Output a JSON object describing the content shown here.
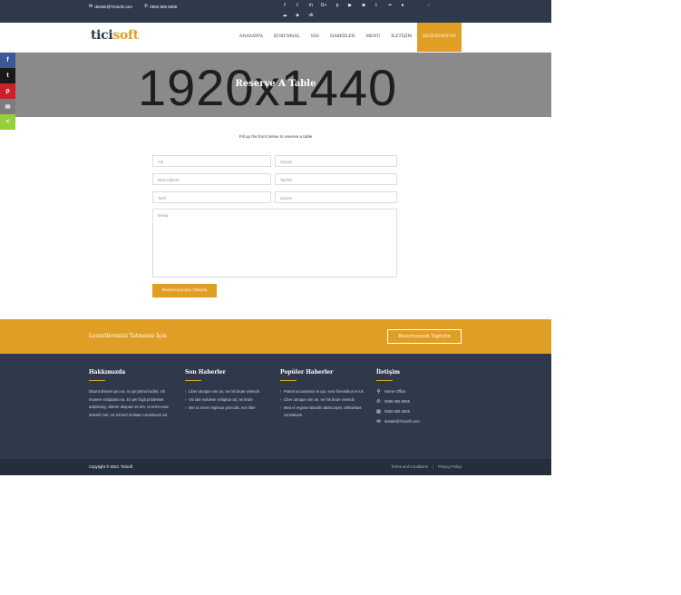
{
  "topbar": {
    "email": "destek@Ticisoft.com",
    "phone": "0555 555 5555",
    "social_icons": [
      "facebook-icon",
      "twitter-icon",
      "linkedin-icon",
      "google-plus-icon",
      "pinterest-icon",
      "youtube-icon",
      "instagram-icon",
      "tumblr-icon",
      "flickr-icon",
      "reddit-icon",
      "whatsapp-icon",
      "soundcloud-icon",
      "dropbox-icon",
      "vk-icon"
    ]
  },
  "logo": {
    "part1": "tici",
    "part2": "soft"
  },
  "nav": {
    "items": [
      "ANASAYFA",
      "KURUMSAL",
      "SSS",
      "HABERLER",
      "MENU",
      "İLETİŞİM",
      "REZERVASYON"
    ],
    "active_index": 6
  },
  "hero": {
    "placeholder": "1920x1440",
    "title": "Reserve A Table"
  },
  "share": {
    "labels": [
      "f",
      "t",
      "p",
      "✉",
      "<"
    ],
    "colors": [
      "#3b5998",
      "#1a1a1a",
      "#cb2027",
      "#7d7d7d",
      "#95d03a"
    ]
  },
  "form": {
    "intro": "Fill up the form below to reserve a table",
    "name_placeholder": "Adı",
    "surname_placeholder": "Soyadı",
    "email_placeholder": "Mail Address",
    "phone_placeholder": "Telefon",
    "date_placeholder": "Tarih",
    "time_placeholder": "Zaman",
    "message_placeholder": "Mesaj",
    "submit_label": "Rezervasyonu Onayla"
  },
  "cta": {
    "text": "Lezzetlerimizi Tatmanız İçin",
    "button_label": "Rezervasyon Yaptırın"
  },
  "footer": {
    "about": {
      "title": "Hakkımızda",
      "text": "Dicunt dissere pro ea, no pri prima facilisi. Sit munere voluptaria ea. Ex per fugit prodesset adipiscing, viderer aliquam et vim. Id enim esse deleniti mel, vix eirmod omittam constituam ad."
    },
    "news": {
      "title": "Son Haberler",
      "items": [
        "Liber utroque vim an, ne his brute vivendo",
        "Vix tale noluisse voluptua ad, ne brute",
        "Mei ut errem legimus periculis, eos liber"
      ]
    },
    "popular": {
      "title": "Popüler Haberler",
      "items": [
        "Putent accusamus te qui, vero forensibus ei lus",
        "Liber utroque vim an, ne his brute vivendo",
        "Mea ei regione blandit ullamcorper, definiebas constituam"
      ]
    },
    "contact": {
      "title": "İletişim",
      "address": "Home Office",
      "phone": "0555 555 5555",
      "fax": "0555 555 5555",
      "email": "destek@Ticisoft.com"
    }
  },
  "bottombar": {
    "copyright": "Copyright © 2023. Ticisoft",
    "terms": "Terms and Conditions",
    "separator": "|",
    "privacy": "Privacy Policy"
  }
}
